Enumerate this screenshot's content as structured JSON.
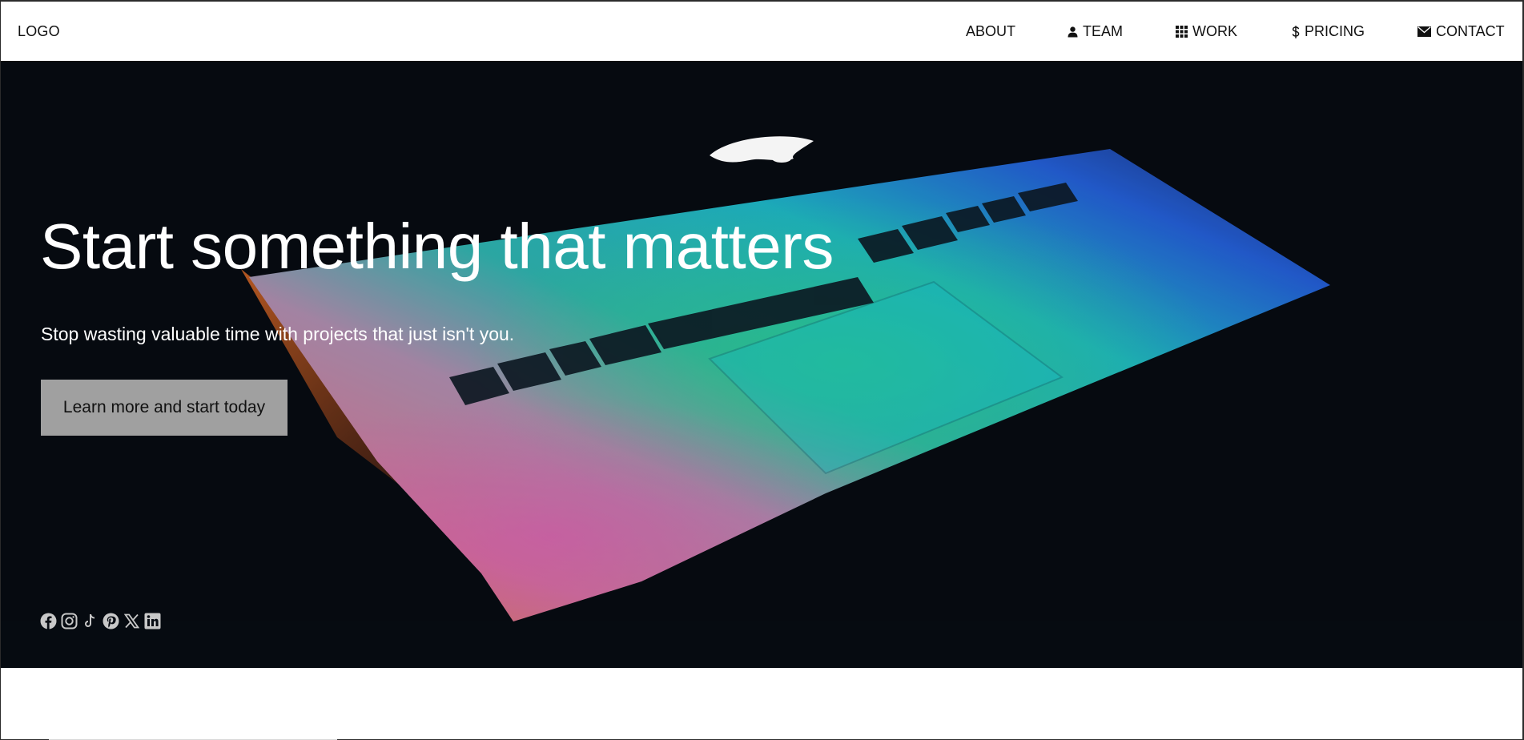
{
  "nav": {
    "logo": "LOGO",
    "items": [
      {
        "label": "ABOUT",
        "icon": ""
      },
      {
        "label": "TEAM",
        "icon": "user-icon"
      },
      {
        "label": "WORK",
        "icon": "grid-icon"
      },
      {
        "label": "PRICING",
        "icon": "dollar-icon"
      },
      {
        "label": "CONTACT",
        "icon": "envelope-icon"
      }
    ]
  },
  "hero": {
    "title": "Start something that matters",
    "subtitle": "Stop wasting valuable time with projects that just isn't you.",
    "cta_label": "Learn more and start today",
    "social_icons": [
      "facebook-icon",
      "instagram-icon",
      "tiktok-icon",
      "pinterest-icon",
      "x-icon",
      "linkedin-icon"
    ]
  },
  "colors": {
    "hero_background": "#070b12",
    "cta_background": "#a0a0a0",
    "social_icon": "#c8c8c8",
    "nav_text": "#111111"
  }
}
